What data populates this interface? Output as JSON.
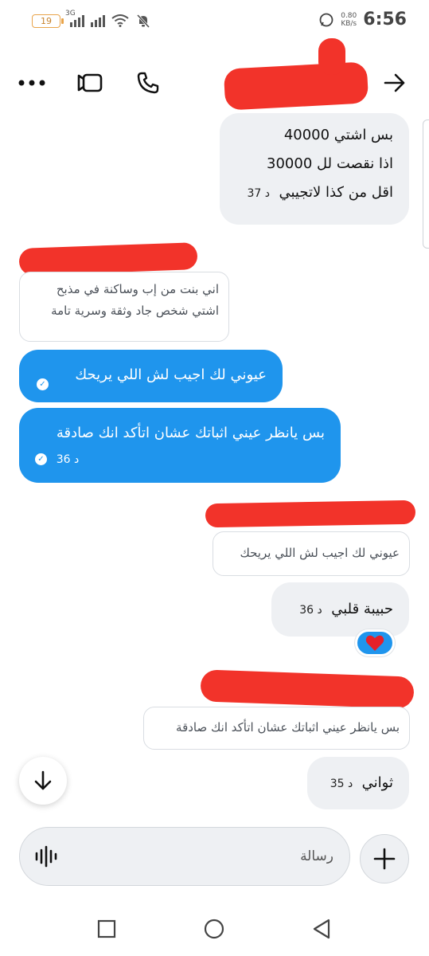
{
  "status_bar": {
    "battery": "19",
    "network": "3G",
    "speed": [
      "0.80",
      "KB/s"
    ],
    "time": "6:56"
  },
  "header": {
    "icons": [
      "more-icon",
      "video-icon",
      "phone-icon",
      "forward-arrow-icon"
    ]
  },
  "messages": {
    "m1": {
      "lines": [
        "بس اشتي 40000",
        "اذا نقصت لل 30000",
        "اقل من كذا لاتجيبي"
      ],
      "time": "37 د"
    },
    "q1": {
      "lines": [
        "اني بنت من إب وساكنة في مذبح",
        "اشتي شخص جاد وثقة وسرية تامة"
      ]
    },
    "m2": {
      "text": "عيوني لك اجيب لش اللي يريحك"
    },
    "m3": {
      "text": "بس يانظر عيني اثباتك عشان اتأكد انك صادقة",
      "time": "36 د"
    },
    "q2": {
      "text": "عيوني لك اجيب لش اللي يريحك"
    },
    "m4": {
      "text": "حبيبة قلبي",
      "time": "36 د"
    },
    "q3": {
      "text": "بس يانظر عيني اثباتك عشان اتأكد انك صادقة"
    },
    "m5": {
      "text": "ثواني",
      "time": "35 د"
    }
  },
  "reaction": {
    "icon": "heart-icon",
    "color": "#e5202a"
  },
  "composer": {
    "placeholder": "رسالة"
  },
  "colors": {
    "accent": "#1f95ed",
    "bubble_gray": "#eef0f3",
    "redaction": "#f2332a"
  }
}
